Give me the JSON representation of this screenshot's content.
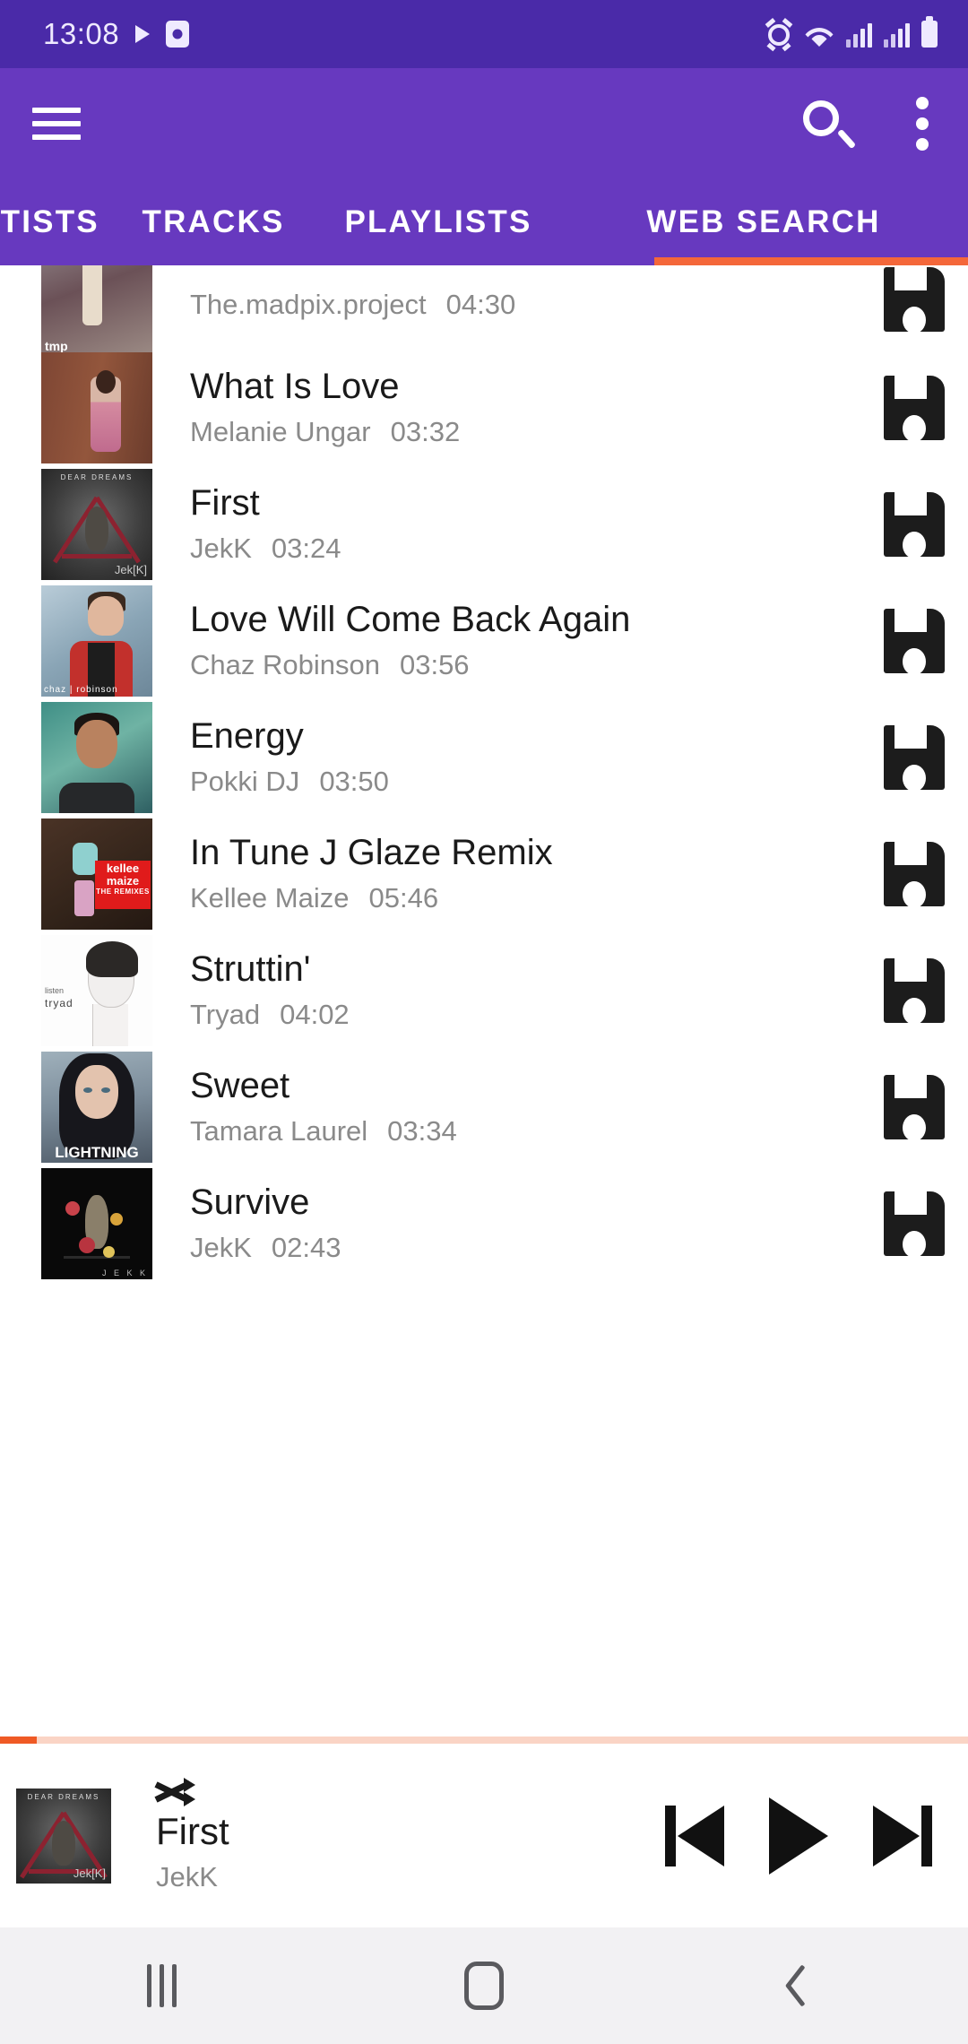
{
  "status_bar": {
    "time": "13:08",
    "icons_left": [
      "play-icon",
      "clock-icon"
    ],
    "icons_right": [
      "alarm-icon",
      "wifi-icon",
      "signal-1-icon",
      "signal-2-icon",
      "battery-icon"
    ]
  },
  "app_bar": {
    "menu_icon": "hamburger-icon",
    "search_icon": "search-icon",
    "overflow_icon": "more-vertical-icon"
  },
  "tabs": {
    "items": [
      {
        "label": "RTISTS",
        "active": false
      },
      {
        "label": "TRACKS",
        "active": false
      },
      {
        "label": "PLAYLISTS",
        "active": false
      },
      {
        "label": "WEB SEARCH",
        "active": true
      }
    ],
    "indicator_color": "#f4673a"
  },
  "tracks": [
    {
      "title": "",
      "artist": "The.madpix.project",
      "duration": "04:30",
      "action": "save-icon"
    },
    {
      "title": "What Is Love",
      "artist": "Melanie Ungar",
      "duration": "03:32",
      "action": "save-icon"
    },
    {
      "title": "First",
      "artist": "JekK",
      "duration": "03:24",
      "action": "save-icon"
    },
    {
      "title": "Love Will Come Back Again",
      "artist": "Chaz Robinson",
      "duration": "03:56",
      "action": "save-icon"
    },
    {
      "title": "Energy",
      "artist": "Pokki DJ",
      "duration": "03:50",
      "action": "save-icon"
    },
    {
      "title": "In Tune  J  Glaze Remix",
      "artist": "Kellee Maize",
      "duration": "05:46",
      "action": "save-icon"
    },
    {
      "title": "Struttin'",
      "artist": "Tryad",
      "duration": "04:02",
      "action": "save-icon"
    },
    {
      "title": "Sweet",
      "artist": "Tamara Laurel",
      "duration": "03:34",
      "action": "save-icon"
    },
    {
      "title": "Survive",
      "artist": "JekK",
      "duration": "02:43",
      "action": "save-icon"
    }
  ],
  "album_art": {
    "jekk_header": "DEAR DREAMS",
    "jekk_footer": "Jek[K]",
    "madpix_caption": "tmp",
    "chaz_caption": "chaz | robinson",
    "kellee_line1": "kellee",
    "kellee_line2": "maize",
    "kellee_line3": "THE REMIXES",
    "tryad_line1": "listen",
    "tryad_line2": "tryad",
    "tamara_caption": "LIGHTNING",
    "survive_footer": "J E K K"
  },
  "player": {
    "shuffle_icon": "shuffle-icon",
    "title": "First",
    "artist": "JekK",
    "previous_icon": "skip-previous-icon",
    "play_icon": "play-icon",
    "next_icon": "skip-next-icon",
    "progress_percent": 4,
    "progress_fill_color": "#ef5a25",
    "progress_track_color": "#fad4c5"
  },
  "nav_bar": {
    "recents_icon": "recents-icon",
    "home_icon": "home-icon",
    "back_icon": "back-icon"
  },
  "theme": {
    "status_bar_bg": "#4a2aa8",
    "app_bar_bg": "#6739bf",
    "accent": "#f4673a",
    "title_color": "#1a1a1a",
    "subtitle_color": "#8a8a8a"
  }
}
